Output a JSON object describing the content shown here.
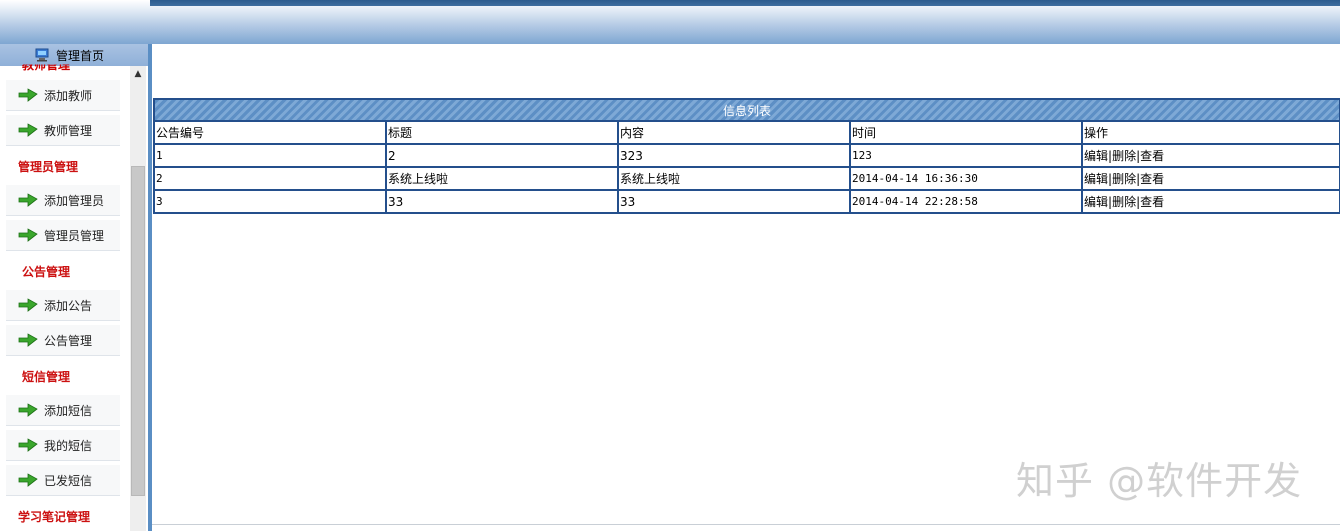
{
  "sidebar": {
    "home_label": "管理首页",
    "cutoff_group": "教师管理",
    "groups": [
      {
        "label": "管理员管理"
      },
      {
        "label": "公告管理"
      },
      {
        "label": "短信管理"
      },
      {
        "label": "学习笔记管理"
      }
    ],
    "items": [
      {
        "label": "添加教师"
      },
      {
        "label": "教师管理"
      },
      {
        "label": "添加管理员"
      },
      {
        "label": "管理员管理"
      },
      {
        "label": "添加公告"
      },
      {
        "label": "公告管理"
      },
      {
        "label": "添加短信"
      },
      {
        "label": "我的短信"
      },
      {
        "label": "已发短信"
      }
    ],
    "scroll_up_icon": "▲"
  },
  "table": {
    "caption": "信息列表",
    "columns": [
      "公告编号",
      "标题",
      "内容",
      "时间",
      "操作"
    ],
    "rows": [
      {
        "id": "1",
        "title": "2",
        "content": "323",
        "time": "123"
      },
      {
        "id": "2",
        "title": "系统上线啦",
        "content": "系统上线啦",
        "time": "2014-04-14 16:36:30"
      },
      {
        "id": "3",
        "title": "33",
        "content": "33",
        "time": "2014-04-14 22:28:58"
      }
    ],
    "actions": {
      "edit": "编辑",
      "delete": "删除",
      "view": "查看",
      "separator": "|"
    }
  },
  "watermark": "知乎 @软件开发",
  "colors": {
    "accent": "#244f8c",
    "group_text": "#cc1111",
    "banner": "#7ea6d2"
  }
}
